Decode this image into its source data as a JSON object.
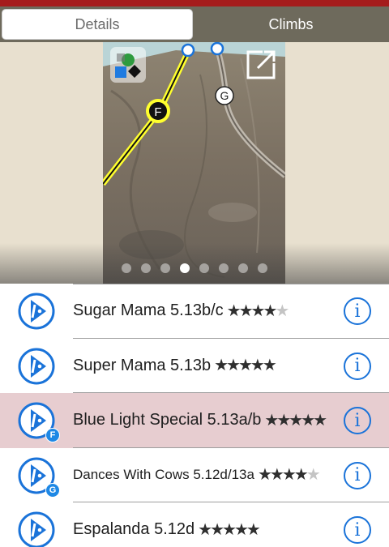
{
  "tabs": {
    "details": "Details",
    "climbs": "Climbs"
  },
  "photo": {
    "markers": {
      "start": "F",
      "other": "G"
    },
    "pager": {
      "count": 8,
      "active_index": 3
    }
  },
  "routes": [
    {
      "name": "Sugar Mama 5.13b/c",
      "stars": 4,
      "badge": "",
      "highlight": false,
      "small": false
    },
    {
      "name": "Super Mama 5.13b",
      "stars": 5,
      "badge": "",
      "highlight": false,
      "small": false
    },
    {
      "name": "Blue Light Special 5.13a/b",
      "stars": 5,
      "badge": "F",
      "highlight": true,
      "small": false
    },
    {
      "name": "Dances With Cows 5.12d/13a",
      "stars": 4,
      "badge": "G",
      "highlight": false,
      "small": true
    },
    {
      "name": "Espalanda 5.12d",
      "stars": 5,
      "badge": "",
      "highlight": false,
      "small": false
    }
  ],
  "colors": {
    "header_red": "#a51c1c",
    "accent_blue": "#1a73d9",
    "highlight_row": "#e7cdd0",
    "tab_bar": "#6e6a5c"
  }
}
